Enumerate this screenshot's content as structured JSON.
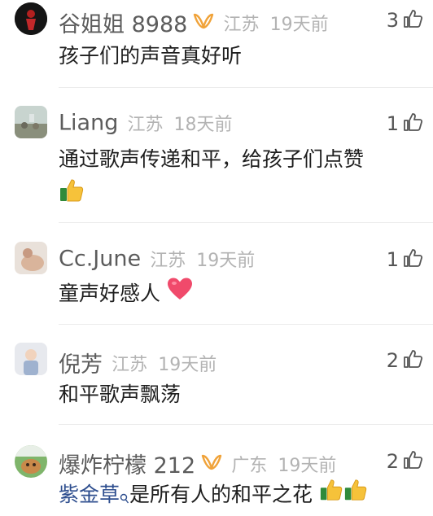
{
  "comments": [
    {
      "name": "谷姐姐 8988",
      "location": "江苏",
      "time": "19天前",
      "likes": "3",
      "text": "孩子们的声音真好听",
      "badge": "vip-badge-icon"
    },
    {
      "name": "Liang",
      "location": "江苏",
      "time": "18天前",
      "likes": "1",
      "text": "通过歌声传递和平，给孩子们点赞",
      "emoji": "thumbs-up-emoji"
    },
    {
      "name": "Cc.June",
      "location": "江苏",
      "time": "19天前",
      "likes": "1",
      "text": "童声好感人",
      "emoji": "heart-emoji"
    },
    {
      "name": "倪芳",
      "location": "江苏",
      "time": "19天前",
      "likes": "2",
      "text": "和平歌声飘荡"
    },
    {
      "name": "爆炸柠檬 212",
      "location": "广东",
      "time": "19天前",
      "likes": "2",
      "mention": "紫金草",
      "text": "是所有人的和平之花",
      "badge": "vip-badge-icon",
      "emoji": "thumbs-up-emoji"
    }
  ],
  "colors": {
    "name": "#5c5c5c",
    "meta": "#b3b3b3",
    "text": "#1e1e1e",
    "mention": "#2f4f8f",
    "badge": "#f0a33a",
    "heart": "#f04a6b"
  }
}
